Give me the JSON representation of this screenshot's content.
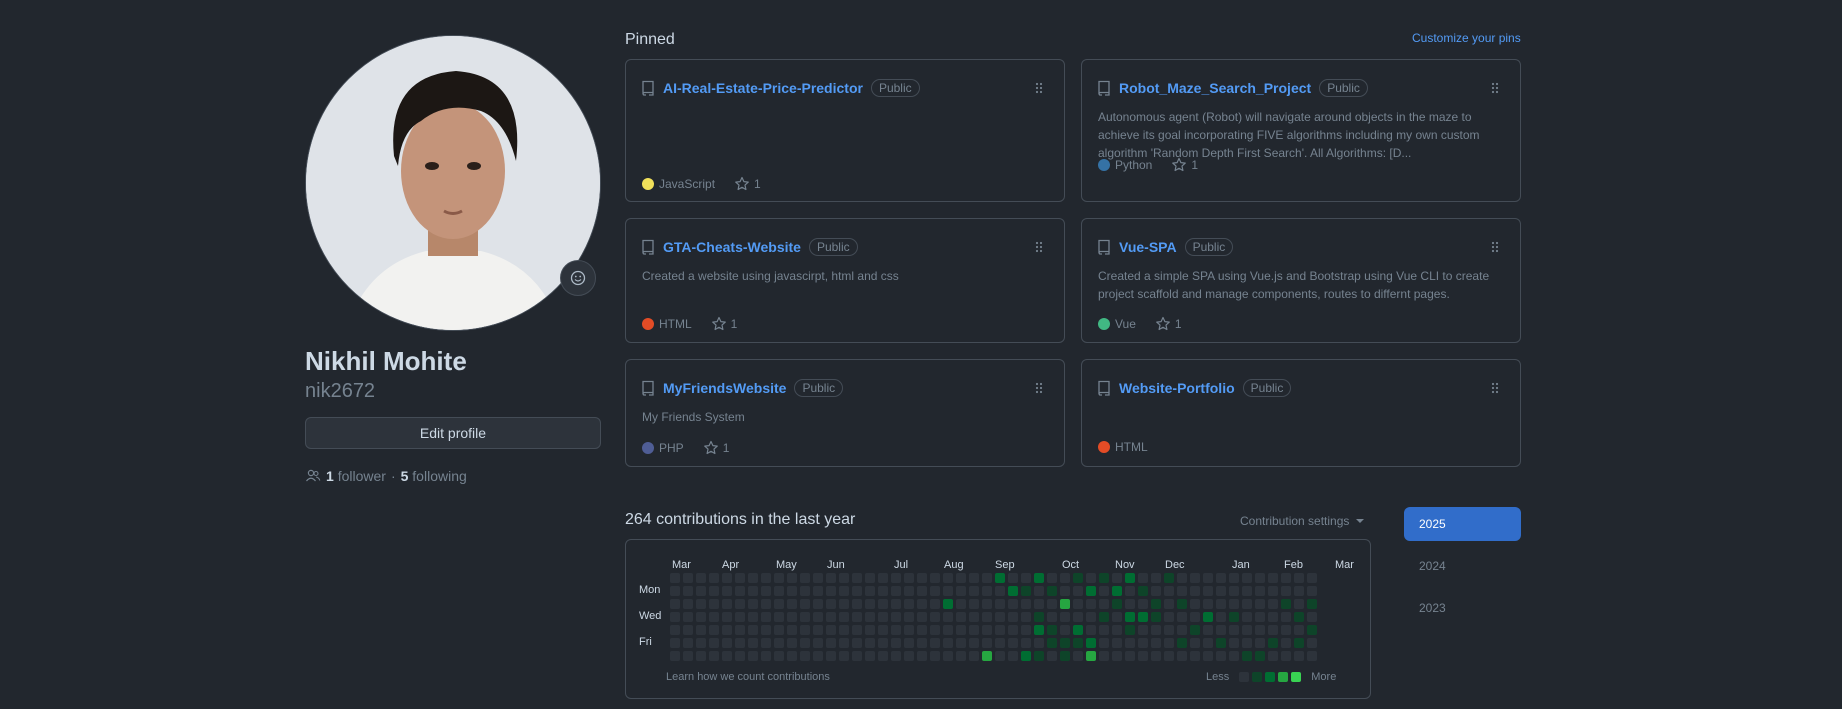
{
  "profile": {
    "name": "Nikhil Mohite",
    "login": "nik2672",
    "edit_label": "Edit profile",
    "followers_count": "1",
    "followers_label": "follower",
    "separator": "·",
    "following_count": "5",
    "following_label": "following"
  },
  "pinned": {
    "title": "Pinned",
    "customize_label": "Customize your pins",
    "repos": [
      {
        "name": "AI-Real-Estate-Price-Predictor",
        "visibility": "Public",
        "description": "",
        "language": "JavaScript",
        "lang_color": "#f1e05a",
        "stars": "1"
      },
      {
        "name": "Robot_Maze_Search_Project",
        "visibility": "Public",
        "description": "Autonomous agent (Robot) will navigate around objects in the maze to achieve its goal incorporating FIVE algorithms including my own custom algorithm 'Random Depth First Search'. All Algorithms: [D...",
        "language": "Python",
        "lang_color": "#3572A5",
        "stars": "1"
      },
      {
        "name": "GTA-Cheats-Website",
        "visibility": "Public",
        "description": "Created a website using javascirpt, html and css",
        "language": "HTML",
        "lang_color": "#e34c26",
        "stars": "1"
      },
      {
        "name": "Vue-SPA",
        "visibility": "Public",
        "description": "Created a simple SPA using Vue.js and Bootstrap using Vue CLI to create project scaffold and manage components, routes to differnt pages.",
        "language": "Vue",
        "lang_color": "#41b883",
        "stars": "1"
      },
      {
        "name": "MyFriendsWebsite",
        "visibility": "Public",
        "description": "My Friends System",
        "language": "PHP",
        "lang_color": "#4F5D95",
        "stars": "1"
      },
      {
        "name": "Website-Portfolio",
        "visibility": "Public",
        "description": "",
        "language": "HTML",
        "lang_color": "#e34c26",
        "stars": ""
      }
    ]
  },
  "contributions": {
    "title": "264 contributions in the last year",
    "settings_label": "Contribution settings",
    "months": [
      "Mar",
      "Apr",
      "May",
      "Jun",
      "Jul",
      "Aug",
      "Sep",
      "Oct",
      "Nov",
      "Dec",
      "Jan",
      "Feb",
      "Mar"
    ],
    "day_labels": [
      "Mon",
      "Wed",
      "Fri"
    ],
    "learn_label": "Learn how we count contributions",
    "less_label": "Less",
    "more_label": "More",
    "level_colors": [
      "#2d333b",
      "#0e4429",
      "#006d32",
      "#26a641",
      "#39d353"
    ],
    "years": [
      "2025",
      "2024",
      "2023"
    ],
    "selected_year": "2025"
  }
}
